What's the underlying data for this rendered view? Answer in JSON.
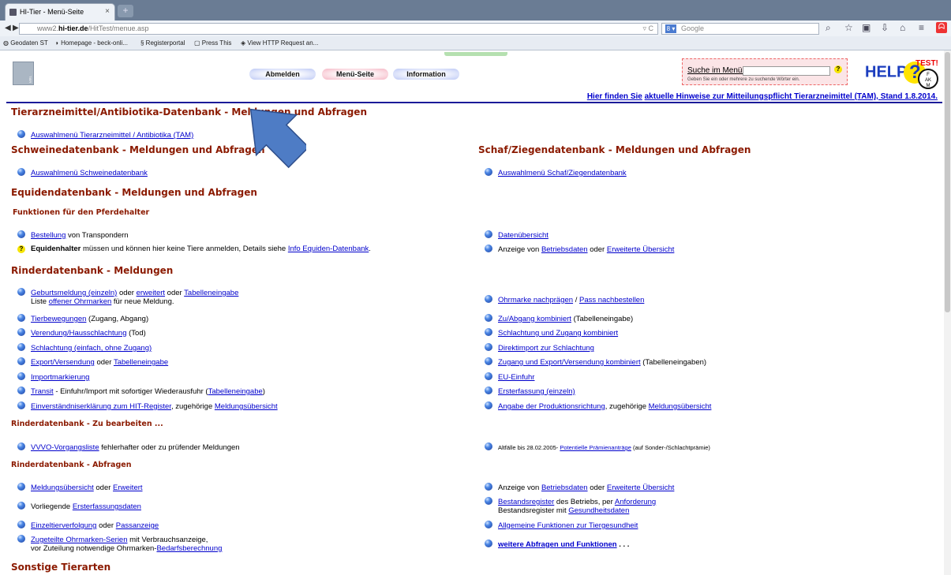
{
  "browser": {
    "tab_title": "HI-Tier - Menü-Seite",
    "tab_close": "×",
    "new_tab": "+",
    "url_prefix": "www2.",
    "url_host": "hi-tier.de",
    "url_path": "/HitTest/menue.asp",
    "url_controls": "▿ C",
    "search_engine": "8 ▾",
    "search_placeholder": "Google",
    "bookmarks": [
      "Geodaten ST",
      "Homepage - beck-onli...",
      "Registerportal",
      "Press This",
      "View HTTP Request an..."
    ]
  },
  "header": {
    "nav": [
      "Abmelden",
      "Menü-Seite",
      "Information"
    ],
    "search_label": "Suche im Menü:",
    "search_hint": "Geben Sie ein oder mehrere zu suchende Wörter ein.",
    "help": "HELP",
    "help_q": "?",
    "test": "TEST!",
    "seal": [
      "F",
      "AK",
      "M"
    ],
    "notice_red": "Hier finden Sie",
    "notice_link": "aktuelle Hinweise zur Mitteilungspflicht Tierarzneimittel (TAM), Stand 1.8.2014."
  },
  "sections": {
    "tam": {
      "heading": "Tierarzneimittel/Antibiotika-Datenbank - Meldungen und Abfragen",
      "item": "Auswahlmenü Tierarzneimittel / Antibiotika (TAM)"
    },
    "schwein": {
      "heading": "Schweinedatenbank - Meldungen und Abfragen",
      "item": "Auswahlmenü Schweinedatenbank"
    },
    "schaf": {
      "heading": "Schaf/Ziegendatenbank - Meldungen und Abfragen",
      "item": "Auswahlmenü Schaf/Ziegendatenbank"
    },
    "equiden": {
      "heading": "Equidendatenbank - Meldungen und Abfragen",
      "sub": "Funktionen für den Pferdehalter",
      "bestellung": "Bestellung",
      "bestellung_rest": " von Transpondern",
      "halter_bold": "Equidenhalter",
      "halter_text": " müssen und können hier keine Tiere anmelden, Details siehe ",
      "halter_link": "Info Equiden-Datenbank",
      "halter_end": ".",
      "datenuebersicht": "Datenübersicht",
      "anzeige": "Anzeige von ",
      "betriebsdaten": "Betriebsdaten",
      "oder": " oder ",
      "erweiterte": "Erweiterte Übersicht"
    },
    "rinder_meldungen": {
      "heading": "Rinderdatenbank - Meldungen",
      "l1_a": "Geburtsmeldung (einzeln)",
      "l1_b": " oder ",
      "l1_c": "erweitert",
      "l1_d": " oder ",
      "l1_e": "Tabelleneingabe",
      "l1_sub_a": "Liste ",
      "l1_sub_b": "offener Ohrmarken",
      "l1_sub_c": " für neue Meldung.",
      "l2_a": "Tierbewegungen",
      "l2_b": " (Zugang, Abgang)",
      "l3_a": "Verendung/Hausschlachtung",
      "l3_b": " (Tod)",
      "l4": "Schlachtung (einfach, ohne Zugang)",
      "l5_a": "Export/Versendung",
      "l5_b": " oder ",
      "l5_c": "Tabelleneingabe",
      "l6": "Importmarkierung",
      "l7_a": "Transit",
      "l7_b": " - Einfuhr/Import mit sofortiger Wiederausfuhr (",
      "l7_c": "Tabelleneingabe",
      "l7_d": ")",
      "l8_a": "Einverständniserklärung zum HIT-Register",
      "l8_b": ", zugehörige ",
      "l8_c": "Meldungsübersicht",
      "r1_a": "Ohrmarke nachprägen",
      "r1_b": " / ",
      "r1_c": "Pass nachbestellen",
      "r2_a": "Zu/Abgang kombiniert",
      "r2_b": " (Tabelleneingabe)",
      "r3": "Schlachtung und Zugang kombiniert",
      "r4": "Direktimport zur Schlachtung",
      "r5_a": "Zugang und Export/Versendung kombiniert",
      "r5_b": " (Tabelleneingaben)",
      "r6": "EU-Einfuhr",
      "r7": "Ersterfassung (einzeln)",
      "r8_a": "Angabe der Produktionsrichtung",
      "r8_b": ", zugehörige ",
      "r8_c": "Meldungsübersicht"
    },
    "rinder_bearbeiten": {
      "heading": "Rinderdatenbank - Zu bearbeiten ...",
      "l1_a": "VVVO-Vorgangsliste",
      "l1_b": " fehlerhafter oder zu prüfender Meldungen",
      "r1_a": "Altfälle bis 28.02.2005- ",
      "r1_b": "Potentielle Prämienanträge",
      "r1_c": " (auf Sonder-/Schlachtprämie)"
    },
    "rinder_abfragen": {
      "heading": "Rinderdatenbank - Abfragen",
      "l1_a": "Meldungsübersicht",
      "l1_b": " oder ",
      "l1_c": "Erweitert",
      "l2_a": "Vorliegende ",
      "l2_b": "Ersterfassungsdaten",
      "l3_a": "Einzeltierverfolgung",
      "l3_b": " oder ",
      "l3_c": "Passanzeige",
      "l4_a": "Zugeteilte Ohrmarken-Serien",
      "l4_b": " mit Verbrauchsanzeige,",
      "l4_sub_a": "vor Zuteilung notwendige Ohrmarken-",
      "l4_sub_b": "Bedarfsberechnung",
      "r1_a": "Anzeige von ",
      "r1_b": "Betriebsdaten",
      "r1_c": " oder ",
      "r1_d": "Erweiterte Übersicht",
      "r2_a": "Bestandsregister",
      "r2_b": " des Betriebs, per ",
      "r2_c": "Anforderung",
      "r2_sub_a": "Bestandsregister mit ",
      "r2_sub_b": "Gesundheitsdaten",
      "r3": "Allgemeine Funktionen zur Tiergesundheit",
      "r4_a": "weitere Abfragen und Funktionen",
      "r4_b": " . . ."
    },
    "sonstige": {
      "heading": "Sonstige Tierarten"
    }
  },
  "colors": {
    "heading": "#8b1a00",
    "link": "#0000cc",
    "accent_blue": "#1b1b99",
    "arrow": "#4e7cc5"
  }
}
